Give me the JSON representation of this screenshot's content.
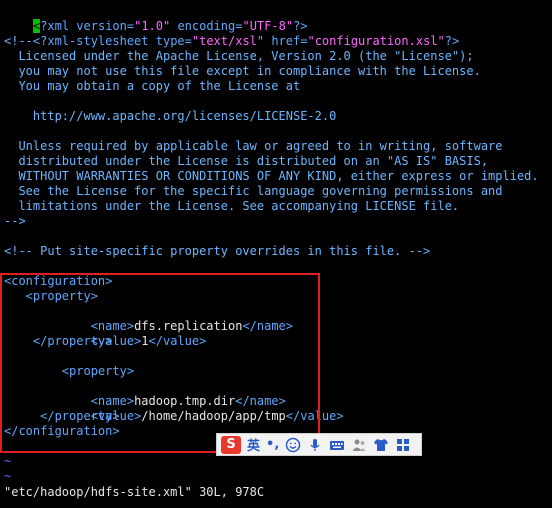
{
  "lines": {
    "l1_cursor": "<",
    "l1_q": "?",
    "l1_xml": "xml",
    "l1_attr1": "version=",
    "l1_val1": "\"1.0\"",
    "l1_attr2": "encoding=",
    "l1_val2": "\"UTF-8\"",
    "l1_end": "?>",
    "l2_start": "<?",
    "l2_name": "xml-stylesheet",
    "l2_attr1": "type=",
    "l2_val1": "\"text/xsl\"",
    "l2_attr2": "href=",
    "l2_val2": "\"configuration.xsl\"",
    "l2_end": "?>",
    "c1": "<!--",
    "c2": "  Licensed under the Apache License, Version 2.0 (the \"License\");",
    "c3": "  you may not use this file except in compliance with the License.",
    "c4": "  You may obtain a copy of the License at",
    "c5": "",
    "c6": "    http://www.apache.org/licenses/LICENSE-2.0",
    "c7": "",
    "c8": "  Unless required by applicable law or agreed to in writing, software",
    "c9": "  distributed under the License is distributed on an \"AS IS\" BASIS,",
    "c10": "  WITHOUT WARRANTIES OR CONDITIONS OF ANY KIND, either express or implied.",
    "c11": "  See the License for the specific language governing permissions and",
    "c12": "  limitations under the License. See accompanying LICENSE file.",
    "c13": "-->",
    "c14": "<!-- Put site-specific property overrides in this file. -->",
    "x1": "<configuration>",
    "x2": "   <property>",
    "x3a": "        <name>",
    "x3b": "dfs.replication",
    "x3c": "</name>",
    "x4a": "        <value>",
    "x4b": "1",
    "x4c": "</value>",
    "x5": "    </property>",
    "x6": "",
    "x7": "        <property>",
    "x8a": "        <name>",
    "x8b": "hadoop.tmp.dir",
    "x8c": "</name>",
    "x9a": "        <value>",
    "x9b": "/home/hadoop/app/tmp",
    "x9c": "</value>",
    "x10": "     </property>",
    "x11": "</configuration>"
  },
  "tildes": [
    "~",
    "~"
  ],
  "status_line": "\"etc/hadoop/hdfs-site.xml\" 30L, 978C",
  "ime": {
    "logo": "S",
    "lang": "英",
    "punct": "•,"
  }
}
